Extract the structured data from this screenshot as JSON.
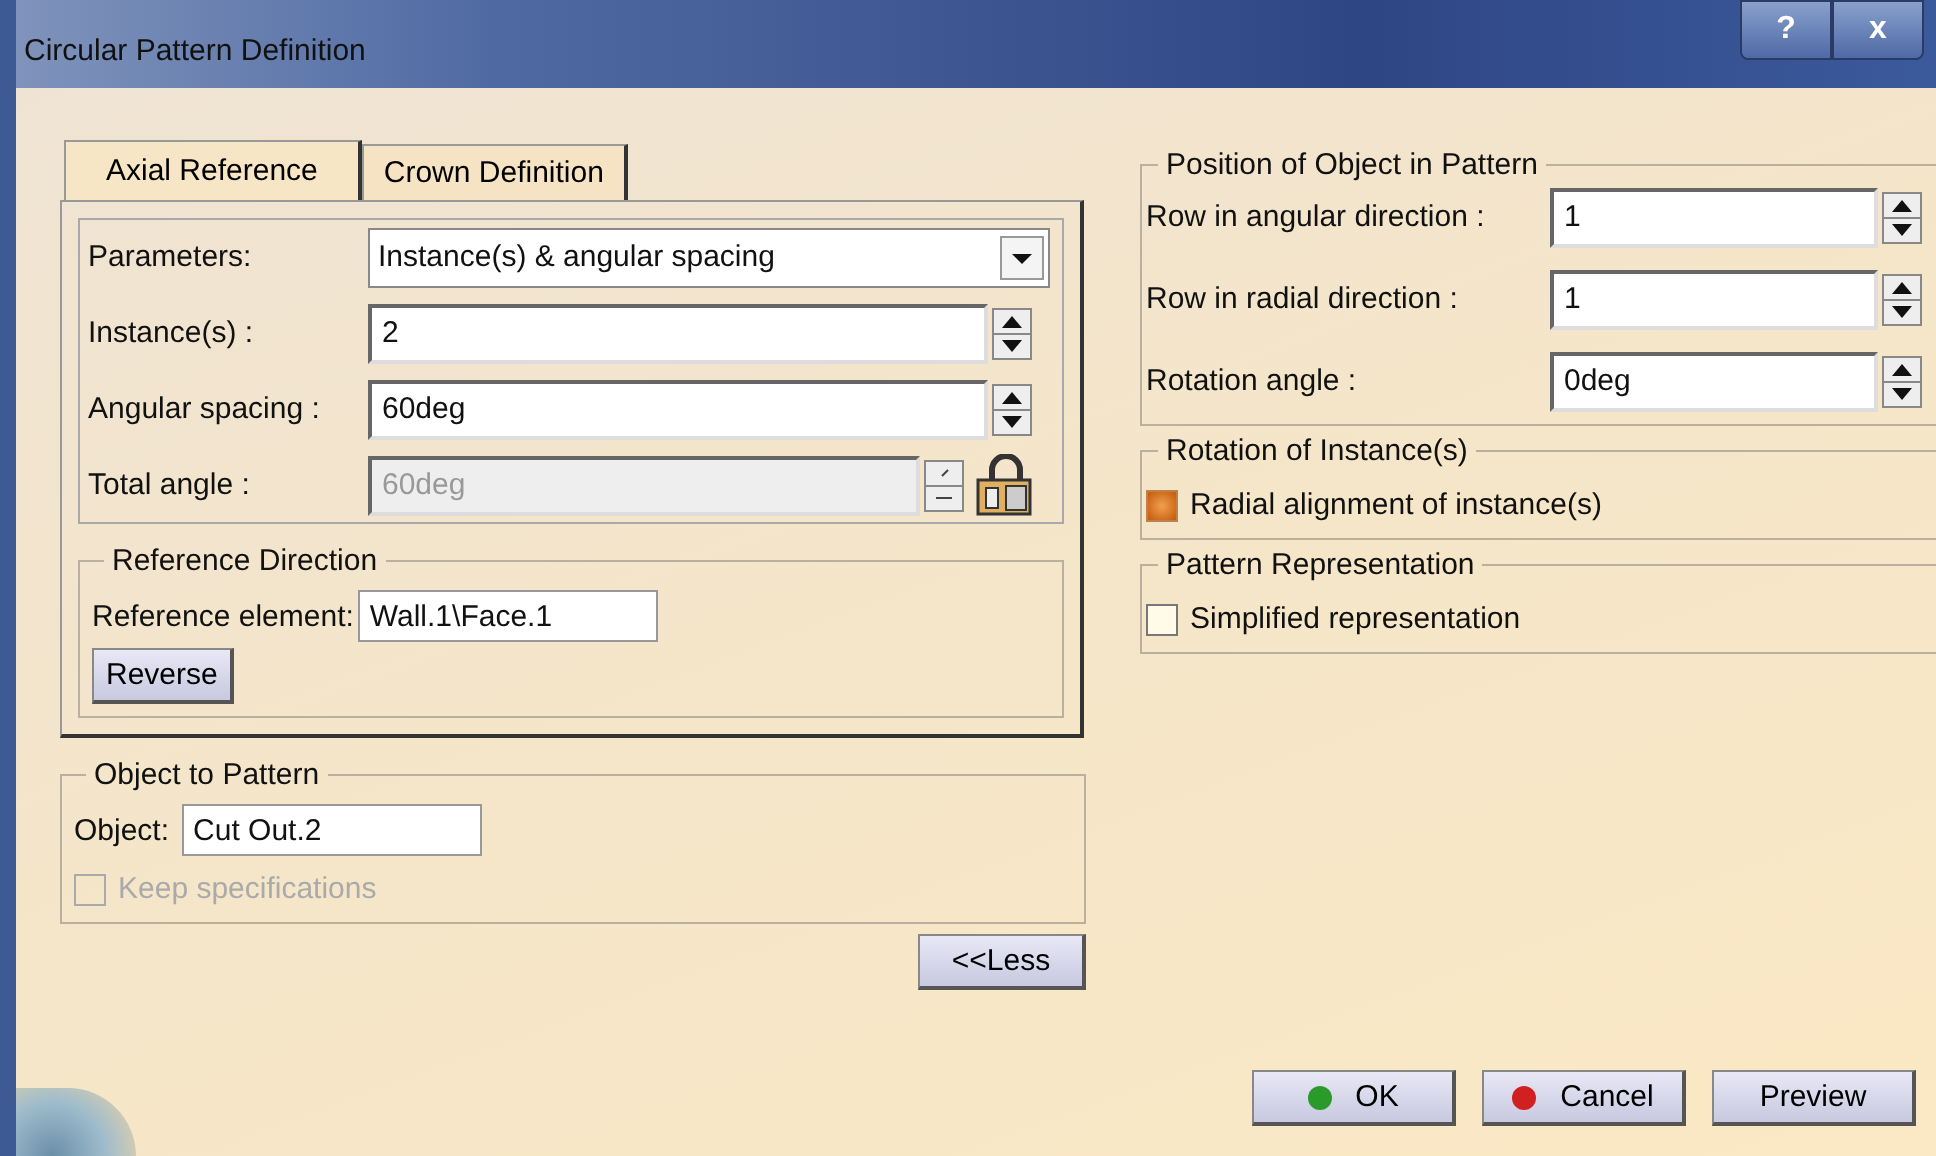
{
  "window": {
    "title": "Circular Pattern Definition",
    "buttons": [
      "?",
      "x"
    ]
  },
  "tabs": [
    {
      "label": "Axial Reference",
      "selected": true
    },
    {
      "label": "Crown Definition",
      "selected": false
    }
  ],
  "parameters": [
    {
      "kind": "dropdown",
      "label": "Parameters:",
      "value": "Instance(s) & angular spacing"
    },
    {
      "kind": "spin",
      "label": "Instance(s) :",
      "value": "2"
    },
    {
      "kind": "spin",
      "label": "Angular spacing :",
      "value": "60deg"
    },
    {
      "kind": "locked",
      "label": "Total angle :",
      "value": "60deg"
    }
  ],
  "reference_direction": {
    "title": "Reference Direction",
    "label": "Reference element:",
    "value": "Wall.1\\Face.1",
    "button": "Reverse"
  },
  "object_to_pattern": {
    "title": "Object to Pattern",
    "label": "Object:",
    "value": "Cut Out.2",
    "checkbox": {
      "label": "Keep specifications",
      "checked": false,
      "disabled": true
    }
  },
  "less_button": "<<Less",
  "position": {
    "title": "Position of Object in Pattern",
    "fields": [
      {
        "label": "Row in angular direction :",
        "value": "1"
      },
      {
        "label": "Row in radial direction :",
        "value": "1"
      },
      {
        "label": "Rotation angle :",
        "value": "0deg"
      }
    ]
  },
  "rotation": {
    "title": "Rotation of Instance(s)",
    "checkbox": {
      "label": "Radial alignment of instance(s)",
      "checked": true,
      "disabled": false
    }
  },
  "representation": {
    "title": "Pattern Representation",
    "checkbox": {
      "label": "Simplified representation",
      "checked": false,
      "disabled": false
    }
  },
  "buttons": [
    {
      "label": "OK",
      "kind": "ok"
    },
    {
      "label": "Cancel",
      "kind": "cancel"
    },
    {
      "label": "Preview",
      "kind": "plain"
    }
  ]
}
